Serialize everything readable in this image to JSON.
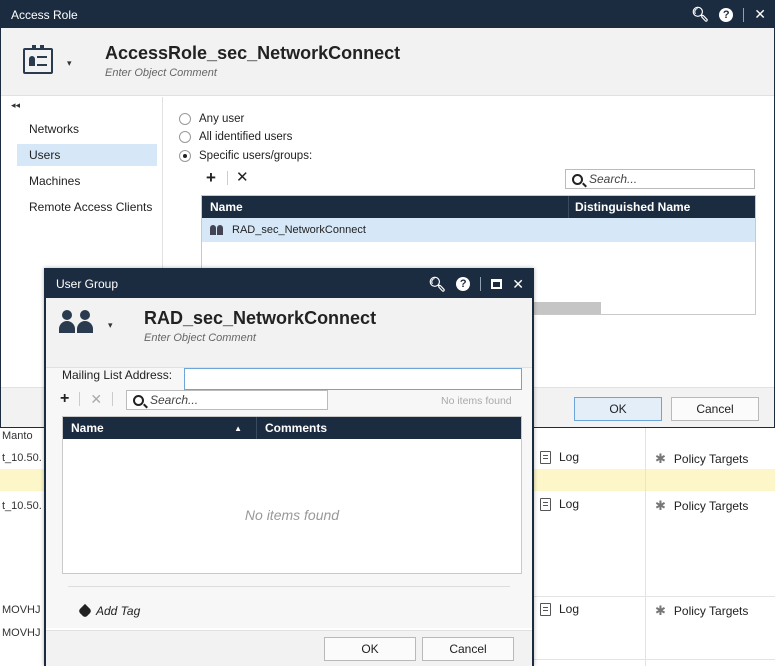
{
  "background": {
    "row_labels": [
      {
        "text": "Manto"
      },
      {
        "text": "t_10.50."
      },
      {
        "text": "t_10.50."
      },
      {
        "text": "MOVHJ"
      },
      {
        "text": "MOVHJ"
      }
    ],
    "log_label": "Log",
    "targets_label": "Policy Targets"
  },
  "access_role": {
    "title": "Access Role",
    "object_name": "AccessRole_sec_NetworkConnect",
    "comment_placeholder": "Enter Object Comment",
    "collapse_glyph": "◂◂",
    "sidebar": [
      {
        "label": "Networks",
        "active": false
      },
      {
        "label": "Users",
        "active": true
      },
      {
        "label": "Machines",
        "active": false
      },
      {
        "label": "Remote Access Clients",
        "active": false
      }
    ],
    "radios": [
      {
        "label": "Any user",
        "checked": false
      },
      {
        "label": "All identified users",
        "checked": false
      },
      {
        "label": "Specific users/groups:",
        "checked": true
      }
    ],
    "search_placeholder": "Search...",
    "table": {
      "columns": [
        "Name",
        "Distinguished Name"
      ],
      "rows": [
        {
          "name": "RAD_sec_NetworkConnect",
          "dn": ""
        }
      ]
    },
    "ok_label": "OK",
    "cancel_label": "Cancel"
  },
  "user_group": {
    "title": "User Group",
    "object_name": "RAD_sec_NetworkConnect",
    "comment_placeholder": "Enter Object Comment",
    "mailing_label": "Mailing List Address:",
    "mailing_value": "",
    "search_placeholder": "Search...",
    "no_items_small": "No items found",
    "table": {
      "columns": [
        "Name",
        "Comments"
      ],
      "empty_message": "No items found"
    },
    "add_tag_label": "Add Tag",
    "ok_label": "OK",
    "cancel_label": "Cancel"
  },
  "colors": {
    "titlebar": "#1c2c40",
    "selection": "#d6e8f8",
    "highlight_row": "#fdf6c8"
  }
}
